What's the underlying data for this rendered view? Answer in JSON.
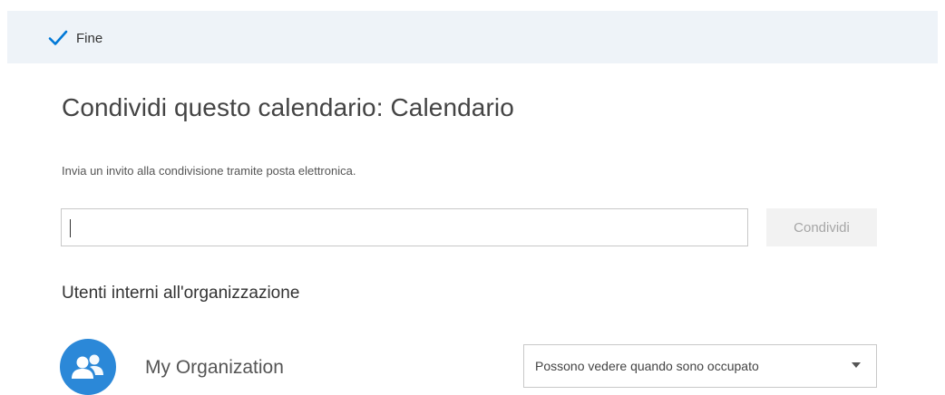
{
  "toolbar": {
    "done_label": "Fine"
  },
  "header": {
    "title": "Condividi questo calendario: Calendario",
    "subtitle": "Invia un invito alla condivisione tramite posta elettronica."
  },
  "invite": {
    "input_value": "",
    "share_label": "Condividi"
  },
  "internal": {
    "heading": "Utenti interni all'organizzazione",
    "organization_name": "My Organization",
    "permission_selected": "Possono vedere quando sono occupato"
  },
  "colors": {
    "accent": "#0078d7",
    "avatar_bg": "#2b88d8",
    "topbar_bg": "#eef3f8"
  },
  "icons": {
    "done": "checkmark-icon",
    "organization": "people-group-icon",
    "dropdown": "chevron-down-icon"
  }
}
